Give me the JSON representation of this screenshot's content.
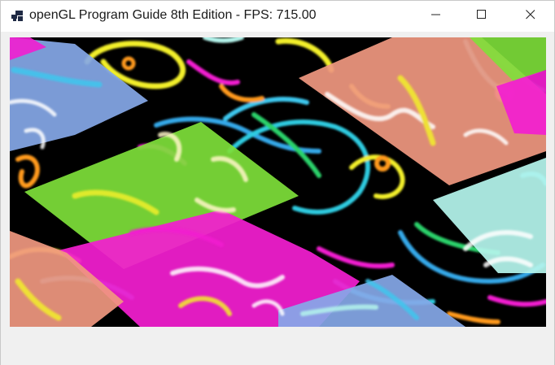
{
  "window": {
    "title": "openGL Program Guide 8th Edition - FPS: 715.00"
  },
  "titlebar_buttons": {
    "minimize": "minimize",
    "maximize": "maximize",
    "close": "close"
  },
  "colors": {
    "titlebar_bg": "#ffffff",
    "client_bg": "#f0f0f0",
    "viewport_bg": "#000000",
    "quad_blue": "#86a8e8",
    "quad_green": "#7ee03a",
    "quad_pink": "#f21ed0",
    "quad_salmon": "#f09880",
    "quad_cyan": "#b4f4ec"
  },
  "icons": {
    "app": "app-icon",
    "minimize": "minimize-icon",
    "maximize": "maximize-icon",
    "close": "close-icon"
  }
}
